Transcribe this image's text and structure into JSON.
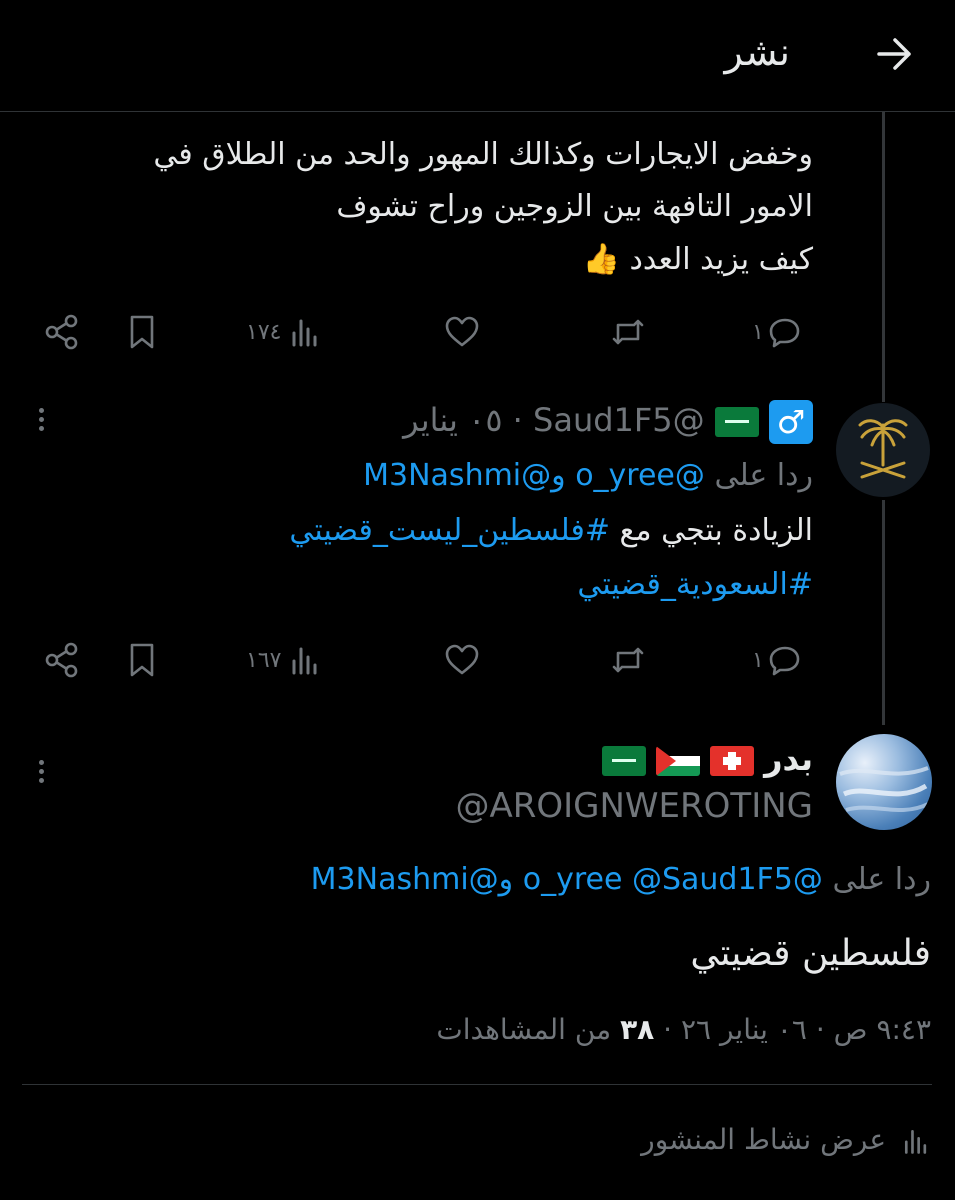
{
  "header": {
    "title": "نشر",
    "back_icon": "arrow-right-icon"
  },
  "tweet1": {
    "lines": [
      "وخفض الايجارات وكذالك المهور والحد من الطلاق في",
      "الامور التافهة بين الزوجين وراح تشوف",
      "كيف يزيد العدد"
    ],
    "emoji": "👍",
    "replies": "١",
    "views": "١٧٤"
  },
  "tweet2": {
    "handle": "@Saud1F5",
    "date": "٠٥ يناير",
    "separator": "·",
    "reply_prefix": "ردا على",
    "reply_to_1": "@o_yree",
    "reply_and": "و",
    "reply_to_2": "@M3Nashmi",
    "text": "الزيادة بتجي مع",
    "hashtag1": "#فلسطين_ليست_قضيتي",
    "hashtag2": "#السعودية_قضيتي",
    "replies": "١",
    "views": "١٦٧"
  },
  "main_tweet": {
    "name": "بدر",
    "handle": "@AROIGNWEROTING",
    "reply_prefix": "ردا على",
    "reply_to_1": "@o_yree",
    "reply_to_2": "@Saud1F5",
    "reply_and": "و",
    "reply_to_3": "@M3Nashmi",
    "text": "فلسطين قضيتي",
    "time": "٩:٤٣ ص",
    "separator": "·",
    "date": "٠٦ يناير ٢٦",
    "views_count": "٣٨",
    "views_label": "من المشاهدات",
    "activity_label": "عرض نشاط المنشور"
  },
  "colors": {
    "background": "#000000",
    "link": "#1d9bf0",
    "muted": "#71767b",
    "text": "#e7e9ea"
  }
}
